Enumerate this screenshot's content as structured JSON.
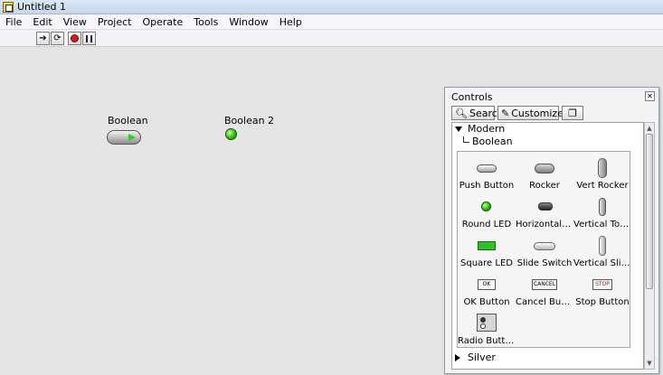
{
  "window": {
    "title": "Untitled 1"
  },
  "menu": [
    "File",
    "Edit",
    "View",
    "Project",
    "Operate",
    "Tools",
    "Window",
    "Help"
  ],
  "front_panel": {
    "controls": [
      {
        "label": "Boolean"
      },
      {
        "label": "Boolean 2"
      }
    ]
  },
  "palette": {
    "title": "Controls",
    "search_label": "Search",
    "customize_label": "Customize",
    "tree": {
      "category": "Modern",
      "subcategory": "Boolean",
      "next_category": "Silver"
    },
    "items": [
      {
        "label": "Push Button"
      },
      {
        "label": "Rocker"
      },
      {
        "label": "Vert Rocker"
      },
      {
        "label": "Round LED"
      },
      {
        "label": "Horizontal T..."
      },
      {
        "label": "Vertical Tog..."
      },
      {
        "label": "Square LED"
      },
      {
        "label": "Slide Switch"
      },
      {
        "label": "Vertical Slide..."
      },
      {
        "label": "OK Button",
        "icon_text": "OK"
      },
      {
        "label": "Cancel Button",
        "icon_text": "CANCEL"
      },
      {
        "label": "Stop Button",
        "icon_text": "STOP"
      },
      {
        "label": "Radio Buttons"
      }
    ]
  }
}
